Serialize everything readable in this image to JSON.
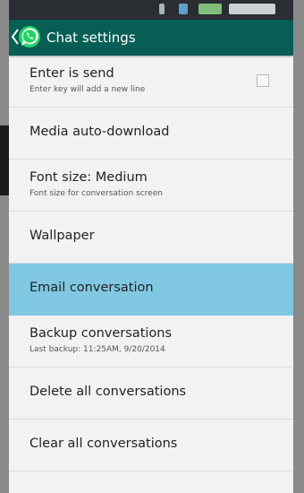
{
  "app_bar": {
    "title": "Chat settings"
  },
  "settings": [
    {
      "title": "Enter is send",
      "subtitle": "Enter key will add a new line",
      "has_checkbox": true,
      "checked": false
    },
    {
      "title": "Media auto-download"
    },
    {
      "title": "Font size: Medium",
      "subtitle": "Font size for conversation screen"
    },
    {
      "title": "Wallpaper"
    },
    {
      "title": "Email conversation",
      "selected": true
    },
    {
      "title": "Backup conversations",
      "subtitle": "Last backup: 11:25AM, 9/20/2014"
    },
    {
      "title": "Delete all conversations"
    },
    {
      "title": "Clear all conversations"
    }
  ],
  "colors": {
    "app_bar": "#075e54",
    "selected_row": "#80c8e2",
    "logo": "#25d366"
  },
  "icons": {
    "back": "chevron-left-icon",
    "logo": "whatsapp-logo-icon"
  }
}
